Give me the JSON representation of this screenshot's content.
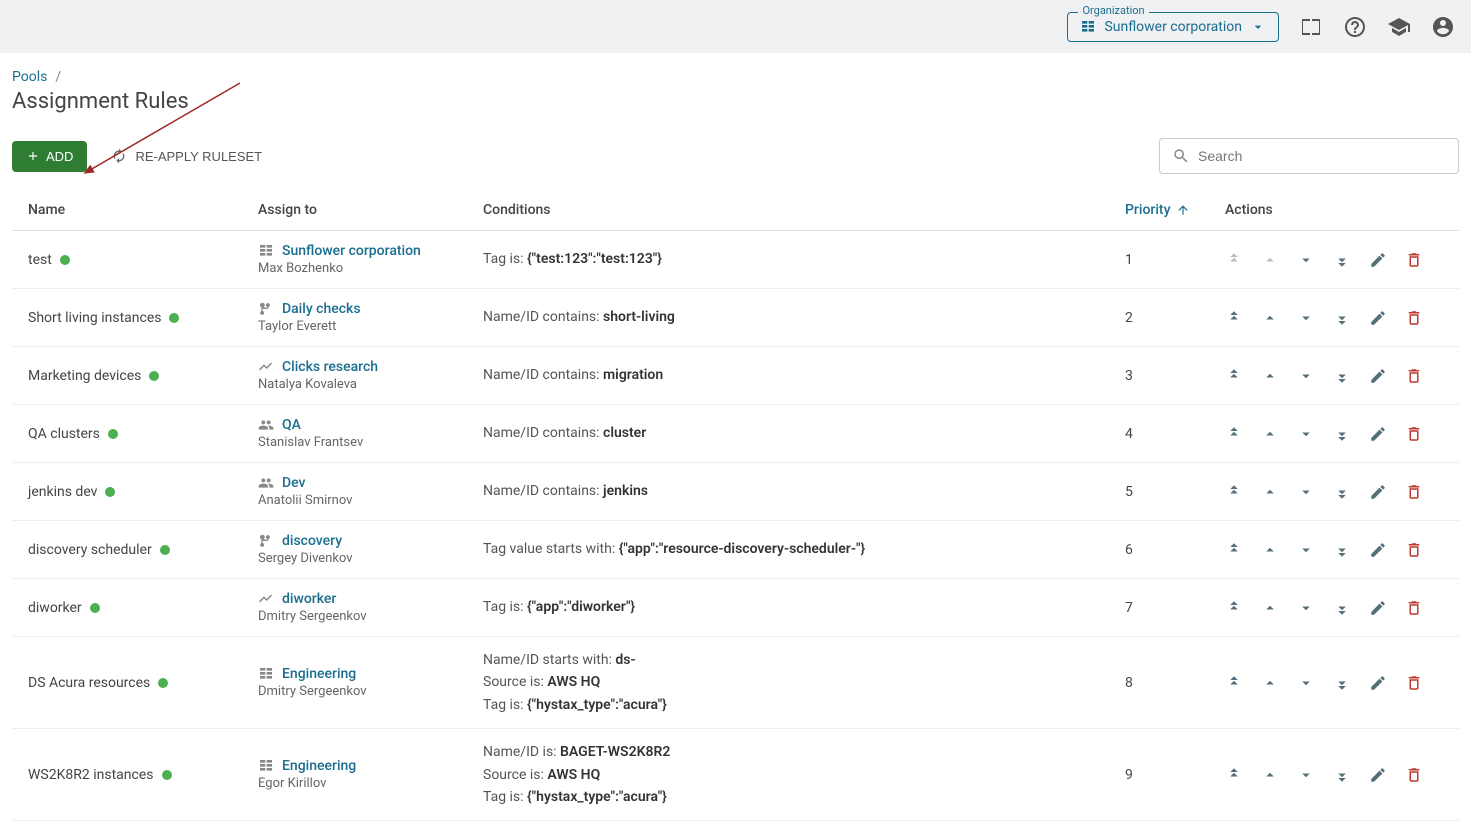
{
  "header": {
    "org_label": "Organization",
    "org_value": "Sunflower corporation"
  },
  "breadcrumb": {
    "parent": "Pools",
    "title": "Assignment Rules"
  },
  "buttons": {
    "add": "ADD",
    "reapply": "RE-APPLY RULESET"
  },
  "search": {
    "placeholder": "Search"
  },
  "columns": {
    "name": "Name",
    "assign_to": "Assign to",
    "conditions": "Conditions",
    "priority": "Priority",
    "actions": "Actions"
  },
  "rows": [
    {
      "name": "test",
      "assign_icon": "org",
      "assign_link": "Sunflower corporation",
      "assign_person": "Max Bozhenko",
      "conditions": [
        {
          "label": "Tag is: ",
          "value": "{\"test:123\":\"test:123\"}"
        }
      ],
      "priority": "1",
      "first": true
    },
    {
      "name": "Short living instances",
      "assign_icon": "branch",
      "assign_link": "Daily checks",
      "assign_person": "Taylor Everett",
      "conditions": [
        {
          "label": "Name/ID contains: ",
          "value": "short-living"
        }
      ],
      "priority": "2"
    },
    {
      "name": "Marketing devices",
      "assign_icon": "chart",
      "assign_link": "Clicks research",
      "assign_person": "Natalya Kovaleva",
      "conditions": [
        {
          "label": "Name/ID contains: ",
          "value": "migration"
        }
      ],
      "priority": "3"
    },
    {
      "name": "QA clusters",
      "assign_icon": "group",
      "assign_link": "QA",
      "assign_person": "Stanislav Frantsev",
      "conditions": [
        {
          "label": "Name/ID contains: ",
          "value": "cluster"
        }
      ],
      "priority": "4"
    },
    {
      "name": "jenkins dev",
      "assign_icon": "group",
      "assign_link": "Dev",
      "assign_person": "Anatolii Smirnov",
      "conditions": [
        {
          "label": "Name/ID contains: ",
          "value": "jenkins"
        }
      ],
      "priority": "5"
    },
    {
      "name": "discovery scheduler",
      "assign_icon": "branch",
      "assign_link": "discovery",
      "assign_person": "Sergey Divenkov",
      "conditions": [
        {
          "label": "Tag value starts with: ",
          "value": "{\"app\":\"resource-discovery-scheduler-\"}"
        }
      ],
      "priority": "6"
    },
    {
      "name": "diworker",
      "assign_icon": "chart",
      "assign_link": "diworker",
      "assign_person": "Dmitry Sergeenkov",
      "conditions": [
        {
          "label": "Tag is: ",
          "value": "{\"app\":\"diworker\"}"
        }
      ],
      "priority": "7"
    },
    {
      "name": "DS Acura resources",
      "assign_icon": "org",
      "assign_link": "Engineering",
      "assign_person": "Dmitry Sergeenkov",
      "conditions": [
        {
          "label": "Name/ID starts with: ",
          "value": "ds-"
        },
        {
          "label": "Source is: ",
          "value": "AWS HQ"
        },
        {
          "label": "Tag is: ",
          "value": "{\"hystax_type\":\"acura\"}"
        }
      ],
      "priority": "8"
    },
    {
      "name": "WS2K8R2 instances",
      "assign_icon": "org",
      "assign_link": "Engineering",
      "assign_person": "Egor Kirillov",
      "conditions": [
        {
          "label": "Name/ID is: ",
          "value": "BAGET-WS2K8R2"
        },
        {
          "label": "Source is: ",
          "value": "AWS HQ"
        },
        {
          "label": "Tag is: ",
          "value": "{\"hystax_type\":\"acura\"}"
        }
      ],
      "priority": "9"
    }
  ]
}
